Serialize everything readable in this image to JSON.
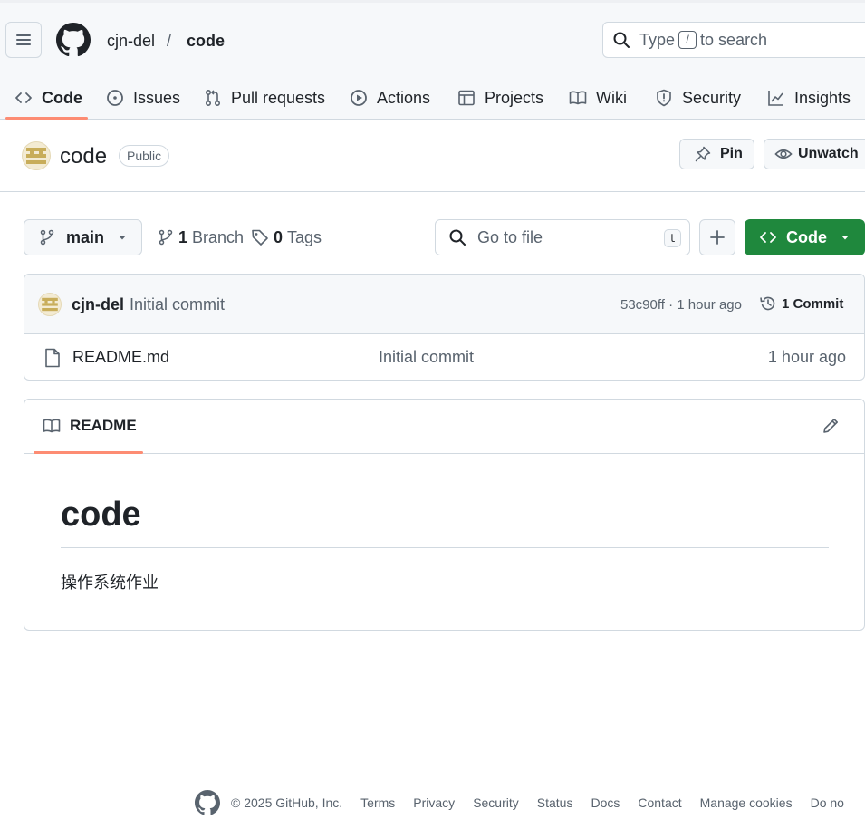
{
  "header": {
    "owner": "cjn-del",
    "separator": "/",
    "repo": "code",
    "search": {
      "before": "Type",
      "key": "/",
      "after": "to search"
    }
  },
  "tabs": [
    {
      "label": "Code",
      "icon": "code-icon",
      "active": true
    },
    {
      "label": "Issues",
      "icon": "issue-opened-icon"
    },
    {
      "label": "Pull requests",
      "icon": "git-pull-request-icon"
    },
    {
      "label": "Actions",
      "icon": "play-icon"
    },
    {
      "label": "Projects",
      "icon": "table-icon"
    },
    {
      "label": "Wiki",
      "icon": "book-icon"
    },
    {
      "label": "Security",
      "icon": "shield-icon"
    },
    {
      "label": "Insights",
      "icon": "graph-icon"
    }
  ],
  "repo": {
    "name": "code",
    "visibility": "Public",
    "pin_label": "Pin",
    "watch_label": "Unwatch"
  },
  "branch_bar": {
    "branch": "main",
    "branch_count": "1",
    "branch_label": "Branch",
    "tag_count": "0",
    "tag_label": "Tags",
    "goto_placeholder": "Go to file",
    "goto_key": "t",
    "code_label": "Code"
  },
  "commit": {
    "author": "cjn-del",
    "message": "Initial commit",
    "sha_time": "53c90ff · 1 hour ago",
    "commits_label": "1 Commit"
  },
  "files": [
    {
      "name": "README.md",
      "message": "Initial commit",
      "time": "1 hour ago",
      "icon": "file-icon"
    }
  ],
  "readme": {
    "tab_label": "README",
    "heading": "code",
    "body": "操作系统作业"
  },
  "footer": {
    "copyright": "© 2025 GitHub, Inc.",
    "links": [
      "Terms",
      "Privacy",
      "Security",
      "Status",
      "Docs",
      "Contact",
      "Manage cookies",
      "Do no"
    ]
  },
  "colors": {
    "accent_underline": "#fd8c73",
    "primary_button": "#1f883d",
    "border": "#d1d9e0",
    "muted_text": "#59636e"
  }
}
